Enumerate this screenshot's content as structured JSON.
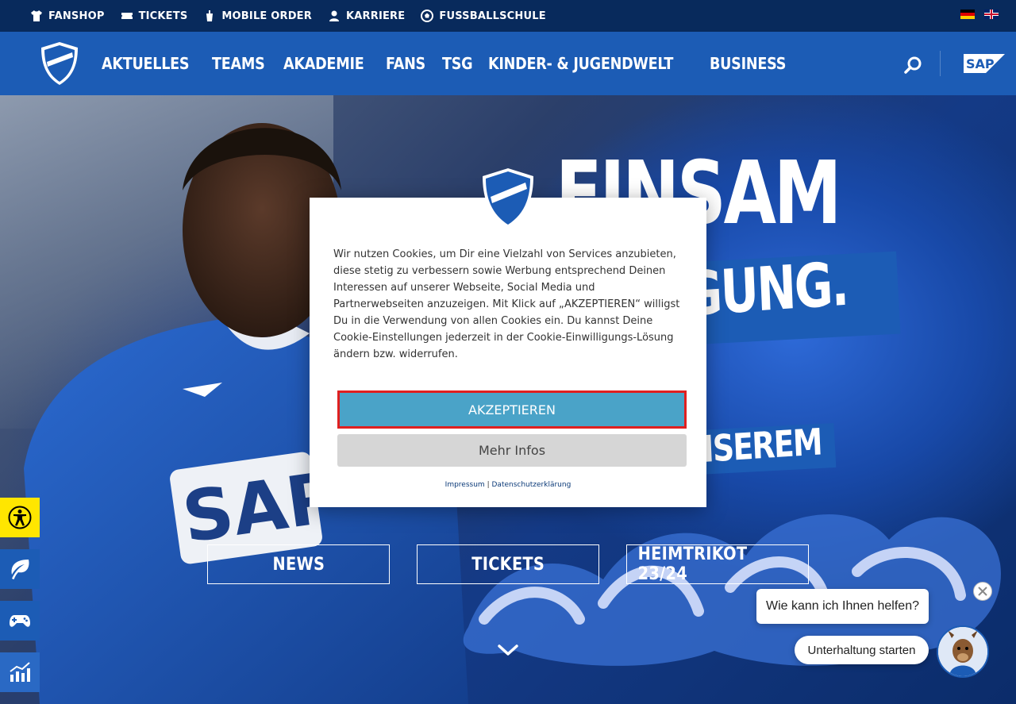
{
  "topbar": {
    "links": [
      {
        "label": "FANSHOP",
        "icon": "shirt-icon"
      },
      {
        "label": "TICKETS",
        "icon": "ticket-icon"
      },
      {
        "label": "MOBILE ORDER",
        "icon": "drink-icon"
      },
      {
        "label": "KARRIERE",
        "icon": "person-icon"
      },
      {
        "label": "FUSSBALLSCHULE",
        "icon": "football-icon"
      }
    ],
    "languages": [
      "de-flag-icon",
      "uk-flag-icon"
    ]
  },
  "nav": {
    "items": [
      "AKTUELLES",
      "TEAMS",
      "AKADEMIE",
      "FANS",
      "TSG",
      "KINDER- & JUGENDWELT",
      "BUSINESS"
    ],
    "sponsor_logo_text": "SAP"
  },
  "hero": {
    "headline": "EINSAM",
    "subline": "VEGUNG.",
    "unserem": "NSEREM",
    "buttons": {
      "news": "NEWS",
      "tickets": "TICKETS",
      "trikot": "HEIMTRIKOT 23/24"
    }
  },
  "cookie": {
    "text": "Wir nutzen Cookies, um Dir eine Vielzahl von Services anzubieten, diese stetig zu verbessern sowie Werbung entsprechend Deinen Interessen auf unserer Webseite, Social Media und Partnerwebseiten anzuzeigen. Mit Klick auf „AKZEPTIEREN“ willigst Du in die Verwendung von allen Cookies ein. Du kannst Deine Cookie-Einstellungen jederzeit in der Cookie-Einwilligungs-Lösung ändern bzw. widerrufen.",
    "accept_label": "AKZEPTIEREN",
    "more_label": "Mehr Infos",
    "impressum": "Impressum",
    "separator": "|",
    "datenschutz": "Datenschutzerklärung"
  },
  "chat": {
    "prompt": "Wie kann ich Ihnen helfen?",
    "start_label": "Unterhaltung starten"
  },
  "colors": {
    "topbar": "#082a5c",
    "nav": "#1c5cb5",
    "accept_button": "#4aa3c8",
    "accept_highlight": "#e02020",
    "accessibility": "#ffe600"
  }
}
